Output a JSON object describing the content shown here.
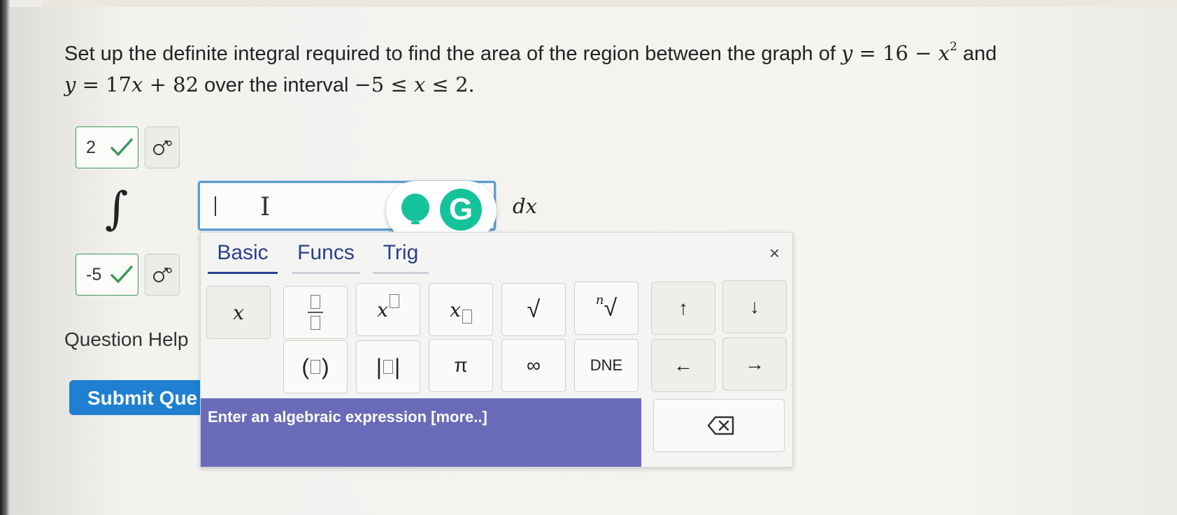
{
  "question": {
    "line1_text": "Set up the definite integral required to find the area of the region between the graph of",
    "func1_lhs": "y",
    "func1_eq": " = 16 − ",
    "func1_var": "x",
    "func1_exp": "2",
    "and_word": "and",
    "func2_lhs": "y",
    "func2_eq": " = 17",
    "func2_var": "x",
    "func2_rest": " + 82",
    "over_text": "over the interval",
    "interval_left": "−5 ≤ ",
    "interval_var": "x",
    "interval_right": " ≤ 2."
  },
  "upper_limit": {
    "value": "2"
  },
  "lower_limit": {
    "value": "-5"
  },
  "integral_symbol": "∫",
  "answer_input": {
    "value": ""
  },
  "differential": "dx",
  "question_help": "Question Help",
  "submit_label": "Submit Que",
  "palette": {
    "tabs": [
      "Basic",
      "Funcs",
      "Trig"
    ],
    "close": "×",
    "keys": {
      "x": "x",
      "x_sup": "x",
      "x_sub": "x",
      "sqrt": "√",
      "nroot_n": "n",
      "nroot_sym": "√",
      "up": "↑",
      "down": "↓",
      "paren_open": "(",
      "paren_close": ")",
      "abs_bar": "|",
      "pi": "π",
      "inf": "∞",
      "dne": "DNE",
      "left": "←",
      "right": "→"
    },
    "hint": "Enter an algebraic expression [more..]"
  },
  "colors": {
    "accent_blue": "#1f7fd0",
    "check_green": "#3c9a5a",
    "palette_hint_bg": "#6a6bb8",
    "grammarly_green": "#15c39a"
  }
}
